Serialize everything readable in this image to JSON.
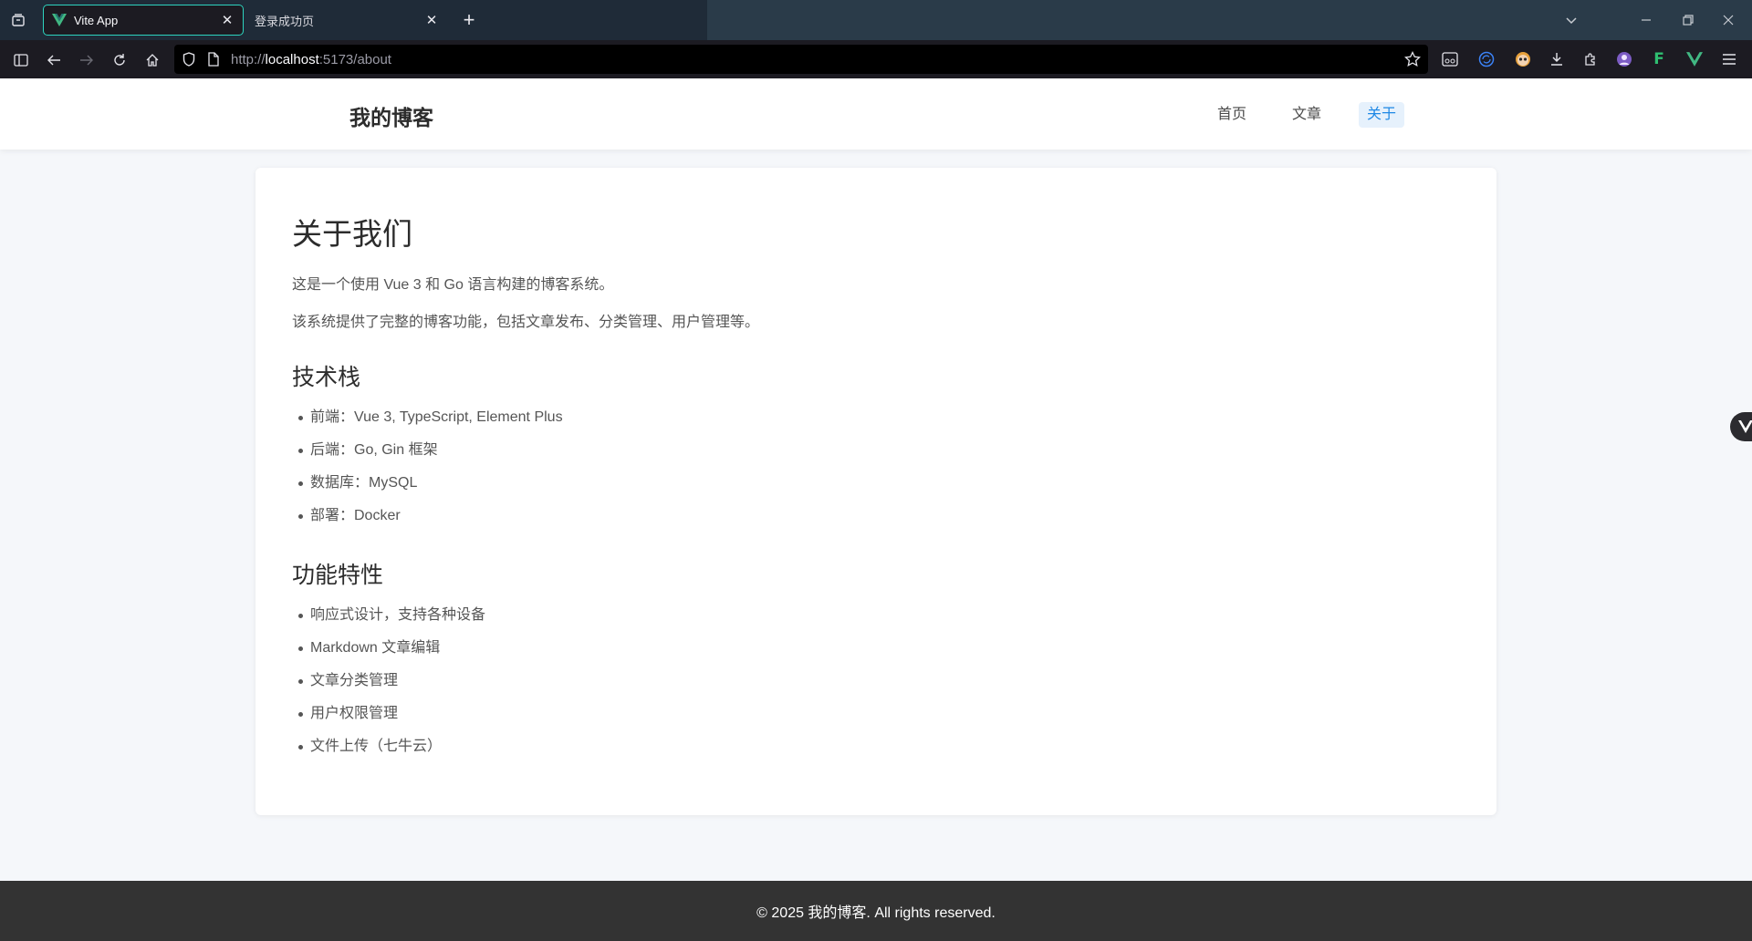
{
  "browser": {
    "tabs": [
      {
        "title": "Vite App",
        "active": true
      },
      {
        "title": "登录成功页",
        "active": false
      }
    ],
    "url_prefix": "http://",
    "url_host": "localhost",
    "url_rest": ":5173/about",
    "icons": {
      "tab_list": "tab-list-icon",
      "back": "back-arrow-icon",
      "forward": "forward-arrow-icon",
      "reload": "reload-icon",
      "home": "home-icon",
      "sidebar": "sidebar-icon",
      "bookmark": "star-icon",
      "downloads": "download-icon",
      "extensions": "puzzle-icon",
      "menu": "hamburger-icon"
    }
  },
  "site": {
    "brand": "我的博客",
    "nav": [
      {
        "label": "首页",
        "active": false
      },
      {
        "label": "文章",
        "active": false
      },
      {
        "label": "关于",
        "active": true
      }
    ]
  },
  "content": {
    "title": "关于我们",
    "paragraphs": [
      "这是一个使用 Vue 3 和 Go 语言构建的博客系统。",
      "该系统提供了完整的博客功能，包括文章发布、分类管理、用户管理等。"
    ],
    "sections": [
      {
        "heading": "技术栈",
        "items": [
          "前端：Vue 3, TypeScript, Element Plus",
          "后端：Go, Gin 框架",
          "数据库：MySQL",
          "部署：Docker"
        ]
      },
      {
        "heading": "功能特性",
        "items": [
          "响应式设计，支持各种设备",
          "Markdown 文章编辑",
          "文章分类管理",
          "用户权限管理",
          "文件上传（七牛云）"
        ]
      }
    ]
  },
  "footer": {
    "text": "© 2025 我的博客. All rights reserved."
  },
  "colors": {
    "accent": "#1e88e5",
    "active_tab_border": "#2dd4bf",
    "vue_green": "#41b883"
  }
}
